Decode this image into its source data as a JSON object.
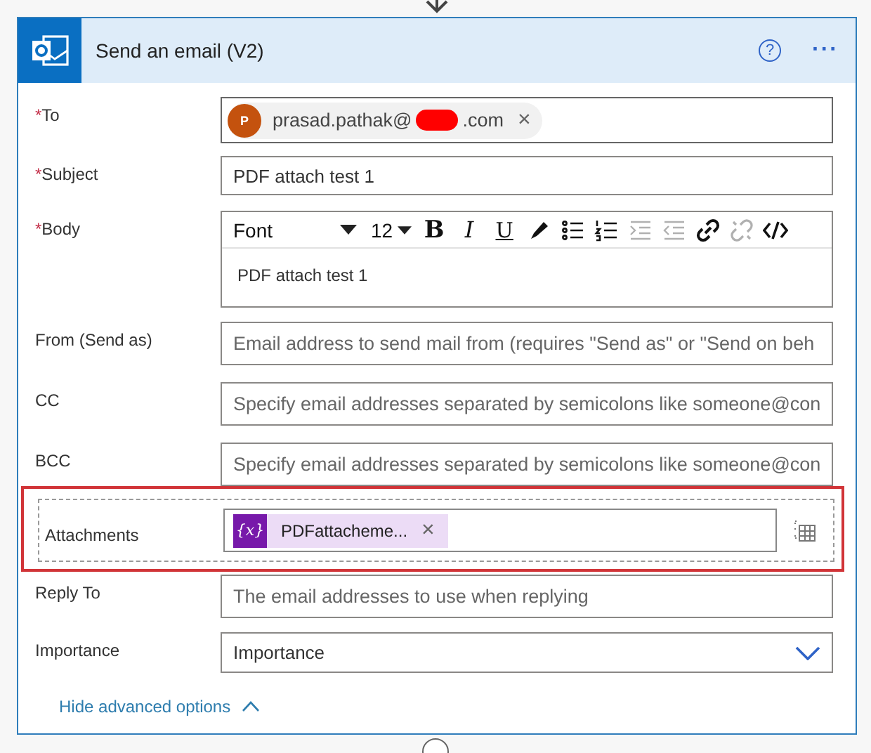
{
  "card": {
    "title": "Send an email (V2)",
    "help_icon": "?",
    "more_icon": "···"
  },
  "fields": [
    {
      "kind": "recipient",
      "label": "To",
      "required_mark": "*",
      "avatar": "P",
      "prefix": "prasad.pathak@",
      "suffix": ".com",
      "redacted": true,
      "remove": "×"
    },
    {
      "kind": "text",
      "label": "Subject",
      "required_mark": "*",
      "value": "PDF attach test 1"
    },
    {
      "kind": "richtext",
      "label": "Body",
      "required_mark": "*",
      "font": "Font",
      "size": "12",
      "value": "PDF attach test 1",
      "tools": [
        {
          "kind": "bold",
          "label": "B",
          "disabled": false
        },
        {
          "kind": "italic",
          "label": "I",
          "disabled": false
        },
        {
          "kind": "underline",
          "label": "U",
          "disabled": false
        },
        {
          "kind": "pen",
          "disabled": false
        },
        {
          "kind": "bullets",
          "disabled": false
        },
        {
          "kind": "numbers",
          "disabled": false
        },
        {
          "kind": "indent",
          "disabled": true
        },
        {
          "kind": "outdent",
          "disabled": true
        },
        {
          "kind": "link",
          "disabled": false
        },
        {
          "kind": "unlink",
          "disabled": true
        },
        {
          "kind": "code",
          "disabled": false
        }
      ]
    },
    {
      "kind": "text",
      "label": "From (Send as)",
      "placeholder": "Email address to send mail from (requires \"Send as\" or \"Send on beh"
    },
    {
      "kind": "text",
      "label": "CC",
      "placeholder": "Specify email addresses separated by semicolons like someone@con"
    },
    {
      "kind": "text",
      "label": "BCC",
      "placeholder": "Specify email addresses separated by semicolons like someone@con"
    },
    {
      "kind": "attachment",
      "label": "Attachments",
      "highlighted": true,
      "token": "PDFattacheme...",
      "token_icon": "{x}",
      "remove": "×"
    },
    {
      "kind": "text",
      "label": "Reply To",
      "placeholder": "The email addresses to use when replying"
    },
    {
      "kind": "dropdown",
      "label": "Importance",
      "value": "Importance"
    }
  ],
  "footer": {
    "link": "Hide advanced options",
    "expanded": true
  }
}
